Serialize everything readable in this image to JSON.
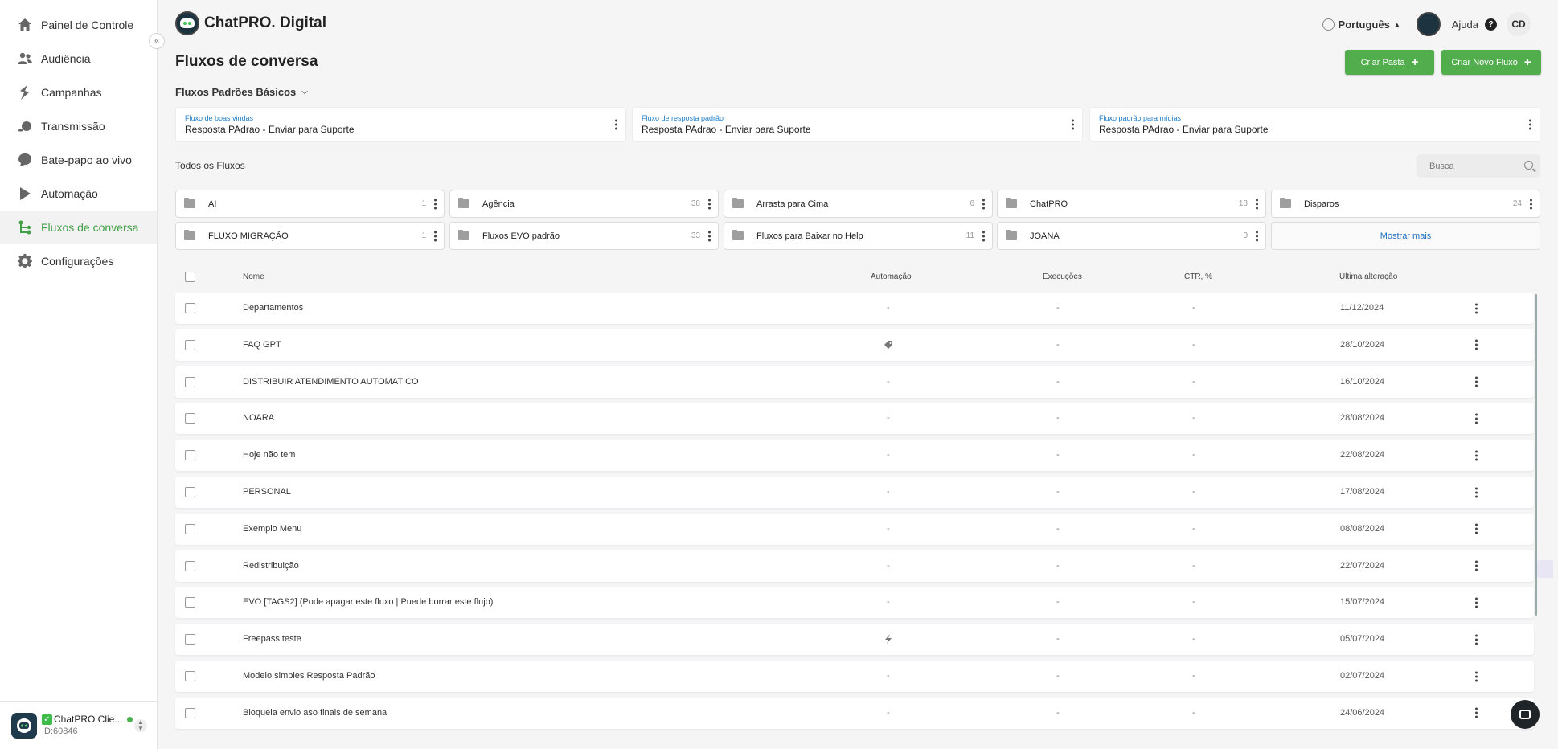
{
  "sidebar": {
    "items": [
      {
        "label": "Painel de Controle",
        "icon": "home-icon"
      },
      {
        "label": "Audiência",
        "icon": "users-icon"
      },
      {
        "label": "Campanhas",
        "icon": "campaign-icon"
      },
      {
        "label": "Transmissão",
        "icon": "broadcast-icon"
      },
      {
        "label": "Bate-papo ao vivo",
        "icon": "chat-bubble-icon"
      },
      {
        "label": "Automação",
        "icon": "automation-icon"
      },
      {
        "label": "Fluxos de conversa",
        "icon": "flow-icon",
        "active": true
      },
      {
        "label": "Configurações",
        "icon": "gear-icon"
      }
    ],
    "footer": {
      "name": "ChatPRO Clie...",
      "id": "ID:60846",
      "check": "✓"
    }
  },
  "header": {
    "brand": "ChatPRO. Digital",
    "language": "Português",
    "help": "Ajuda",
    "user_initials": "CD"
  },
  "page": {
    "title": "Fluxos de conversa",
    "create_folder": "Criar Pasta",
    "create_flow": "Criar Novo Fluxo",
    "default_section": "Fluxos Padrões Básicos",
    "defaults": [
      {
        "label": "Fluxo de boas vindas",
        "value": "Resposta PAdrao - Enviar para Suporte"
      },
      {
        "label": "Fluxo de resposta padrão",
        "value": "Resposta PAdrao - Enviar para Suporte"
      },
      {
        "label": "Fluxo padrão para mídias",
        "value": "Resposta PAdrao - Enviar para Suporte"
      }
    ],
    "all_flows": "Todos os Fluxos",
    "search_placeholder": "Busca",
    "show_more": "Mostrar mais"
  },
  "folders": [
    {
      "name": "AI",
      "count": "1"
    },
    {
      "name": "Agência",
      "count": "38"
    },
    {
      "name": "Arrasta para Cima",
      "count": "6"
    },
    {
      "name": "ChatPRO",
      "count": "18"
    },
    {
      "name": "Disparos",
      "count": "24"
    },
    {
      "name": "FLUXO MIGRAÇÃO",
      "count": "1"
    },
    {
      "name": "Fluxos EVO padrão",
      "count": "33"
    },
    {
      "name": "Fluxos para Baixar no Help",
      "count": "11"
    },
    {
      "name": "JOANA",
      "count": "0"
    }
  ],
  "table": {
    "headers": {
      "name": "Nome",
      "automation": "Automação",
      "runs": "Execuções",
      "ctr": "CTR, %",
      "updated": "Última alteração"
    },
    "rows": [
      {
        "name": "Departamentos",
        "automation": "-",
        "runs": "-",
        "ctr": "-",
        "updated": "11/12/2024"
      },
      {
        "name": "FAQ GPT",
        "automation": "",
        "automation_icon": "tag-icon",
        "runs": "-",
        "ctr": "-",
        "updated": "28/10/2024"
      },
      {
        "name": "DISTRIBUIR ATENDIMENTO AUTOMATICO",
        "automation": "-",
        "runs": "-",
        "ctr": "-",
        "updated": "16/10/2024"
      },
      {
        "name": "NOARA",
        "automation": "-",
        "runs": "-",
        "ctr": "-",
        "updated": "28/08/2024"
      },
      {
        "name": "Hoje não tem",
        "automation": "-",
        "runs": "-",
        "ctr": "-",
        "updated": "22/08/2024"
      },
      {
        "name": "PERSONAL",
        "automation": "-",
        "runs": "-",
        "ctr": "-",
        "updated": "17/08/2024"
      },
      {
        "name": "Exemplo Menu",
        "automation": "-",
        "runs": "-",
        "ctr": "-",
        "updated": "08/08/2024"
      },
      {
        "name": "Redistribuição",
        "automation": "-",
        "runs": "-",
        "ctr": "-",
        "updated": "22/07/2024"
      },
      {
        "name": "EVO [TAGS2] (Pode apagar este fluxo | Puede borrar este flujo)",
        "automation": "-",
        "runs": "-",
        "ctr": "-",
        "updated": "15/07/2024"
      },
      {
        "name": "Freepass teste",
        "automation": "",
        "automation_icon": "bolt-icon",
        "runs": "-",
        "ctr": "-",
        "updated": "05/07/2024"
      },
      {
        "name": "Modelo simples Resposta Padrão",
        "automation": "-",
        "runs": "-",
        "ctr": "-",
        "updated": "02/07/2024"
      },
      {
        "name": "Bloqueia envio aso finais de semana",
        "automation": "-",
        "runs": "-",
        "ctr": "-",
        "updated": "24/06/2024"
      }
    ]
  },
  "colors": {
    "accent": "#52ae4d",
    "active_nav": "#43a047",
    "link": "#1e7ecb"
  }
}
